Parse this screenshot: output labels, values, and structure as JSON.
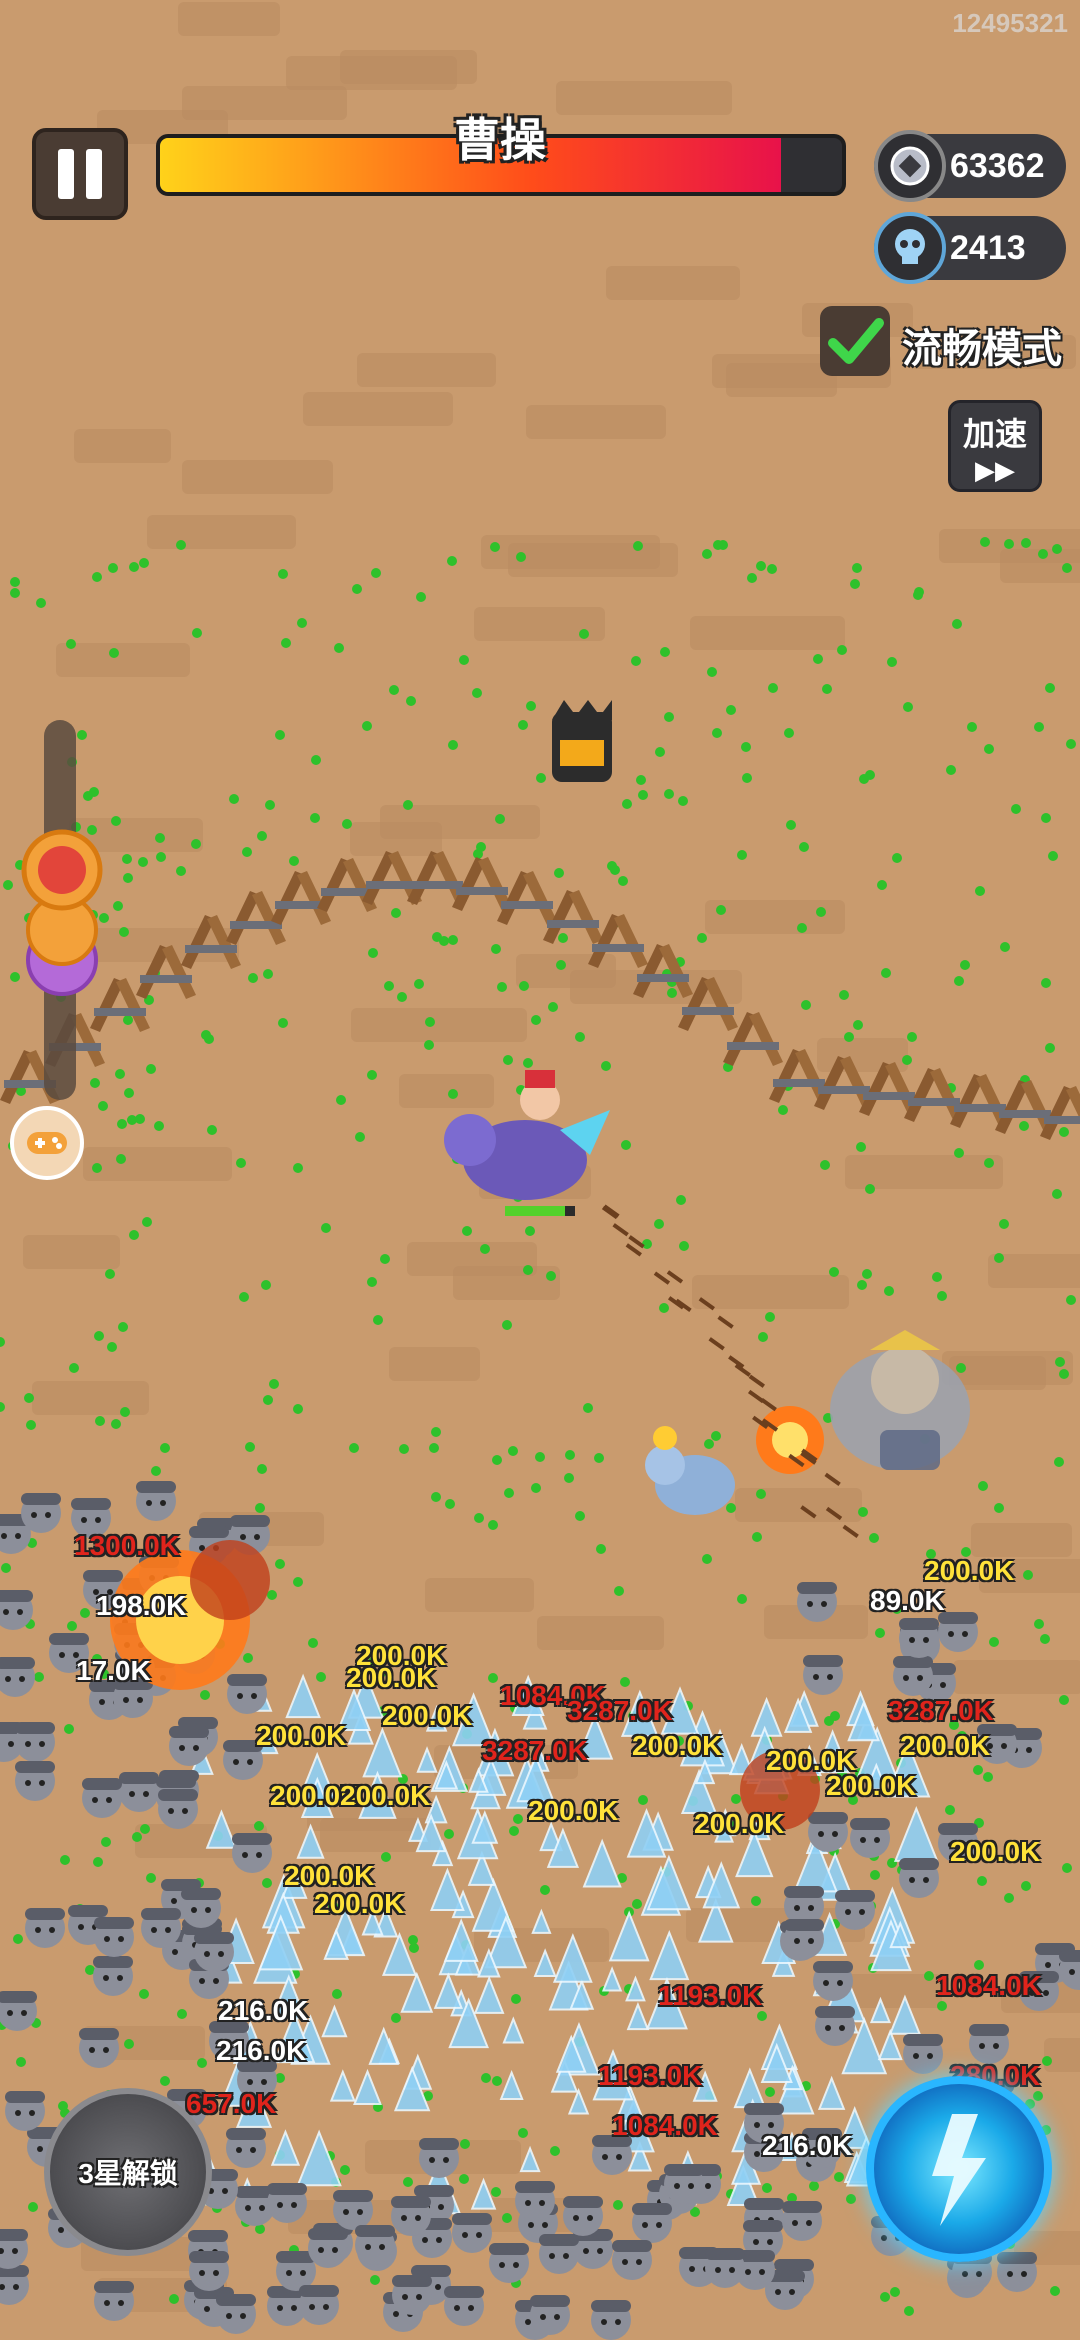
{
  "top_id": "12495321",
  "boss": {
    "name": "曹操",
    "health_fraction": 0.91
  },
  "coins": "63362",
  "kills": "2413",
  "smooth_mode": {
    "label": "流畅模式",
    "checked": true
  },
  "speed_button": {
    "label": "加速",
    "arrow": "▶▶"
  },
  "unlock_button": {
    "label": "3星解锁"
  },
  "colors": {
    "ground": "#c99b6e",
    "orb": "#2ec12b",
    "damage_yellow": "#ffe23a",
    "damage_red": "#e0241c",
    "ice": "#8fd0f5"
  },
  "damage_numbers": [
    {
      "text": "1300.0K",
      "color": "r"
    },
    {
      "text": "198.0K",
      "color": "w"
    },
    {
      "text": "17.0K",
      "color": "w"
    },
    {
      "text": "200.0K",
      "color": "y"
    },
    {
      "text": "200.0K",
      "color": "y"
    },
    {
      "text": "200.0K",
      "color": "y"
    },
    {
      "text": "1084.0K",
      "color": "r"
    },
    {
      "text": "3287.0K",
      "color": "r"
    },
    {
      "text": "3287.0K",
      "color": "r"
    },
    {
      "text": "200.0K",
      "color": "y"
    },
    {
      "text": "3287.0K",
      "color": "r"
    },
    {
      "text": "200.0K",
      "color": "y"
    },
    {
      "text": "200.0K",
      "color": "y"
    },
    {
      "text": "89.0K",
      "color": "w"
    },
    {
      "text": "200.0K",
      "color": "y"
    },
    {
      "text": "200.0K",
      "color": "y"
    },
    {
      "text": "200.0K",
      "color": "y"
    },
    {
      "text": "200.0K",
      "color": "y"
    },
    {
      "text": "200.0K",
      "color": "y"
    },
    {
      "text": "200.0K",
      "color": "y"
    },
    {
      "text": "200.0K",
      "color": "y"
    },
    {
      "text": "200.0K",
      "color": "y"
    },
    {
      "text": "200.0K",
      "color": "y"
    },
    {
      "text": "200.0K",
      "color": "y"
    },
    {
      "text": "216.0K",
      "color": "w"
    },
    {
      "text": "216.0K",
      "color": "w"
    },
    {
      "text": "1193.0K",
      "color": "r"
    },
    {
      "text": "1193.0K",
      "color": "r"
    },
    {
      "text": "1084.0K",
      "color": "r"
    },
    {
      "text": "216.0K",
      "color": "w"
    },
    {
      "text": "657.0K",
      "color": "r"
    },
    {
      "text": "280.0K",
      "color": "r"
    },
    {
      "text": "1084.0K",
      "color": "r"
    }
  ]
}
